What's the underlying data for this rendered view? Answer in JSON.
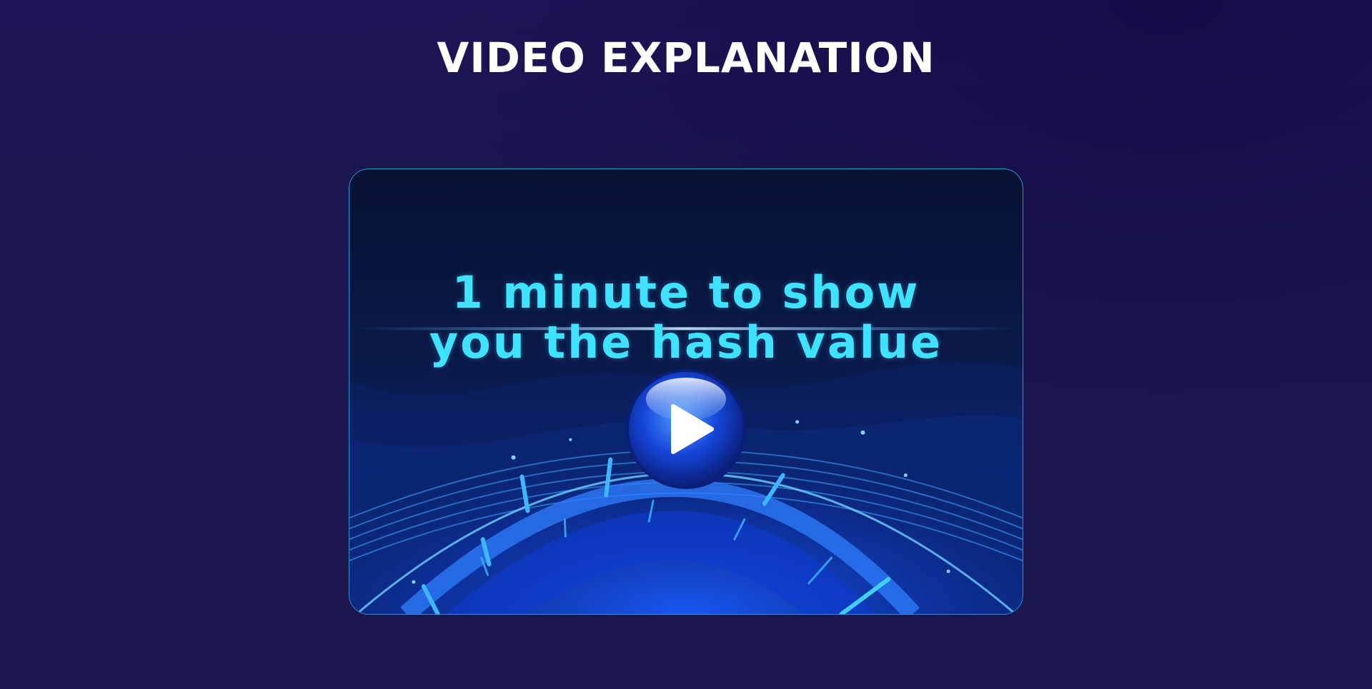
{
  "section": {
    "title": "VIDEO EXPLANATION"
  },
  "video": {
    "caption_line1": "1 minute to show",
    "caption_line2": "you the hash value",
    "play_icon": "play-icon",
    "colors": {
      "caption": "#3fe3ff",
      "card_border": "#2e8fd6",
      "background": "#1b174e"
    }
  }
}
